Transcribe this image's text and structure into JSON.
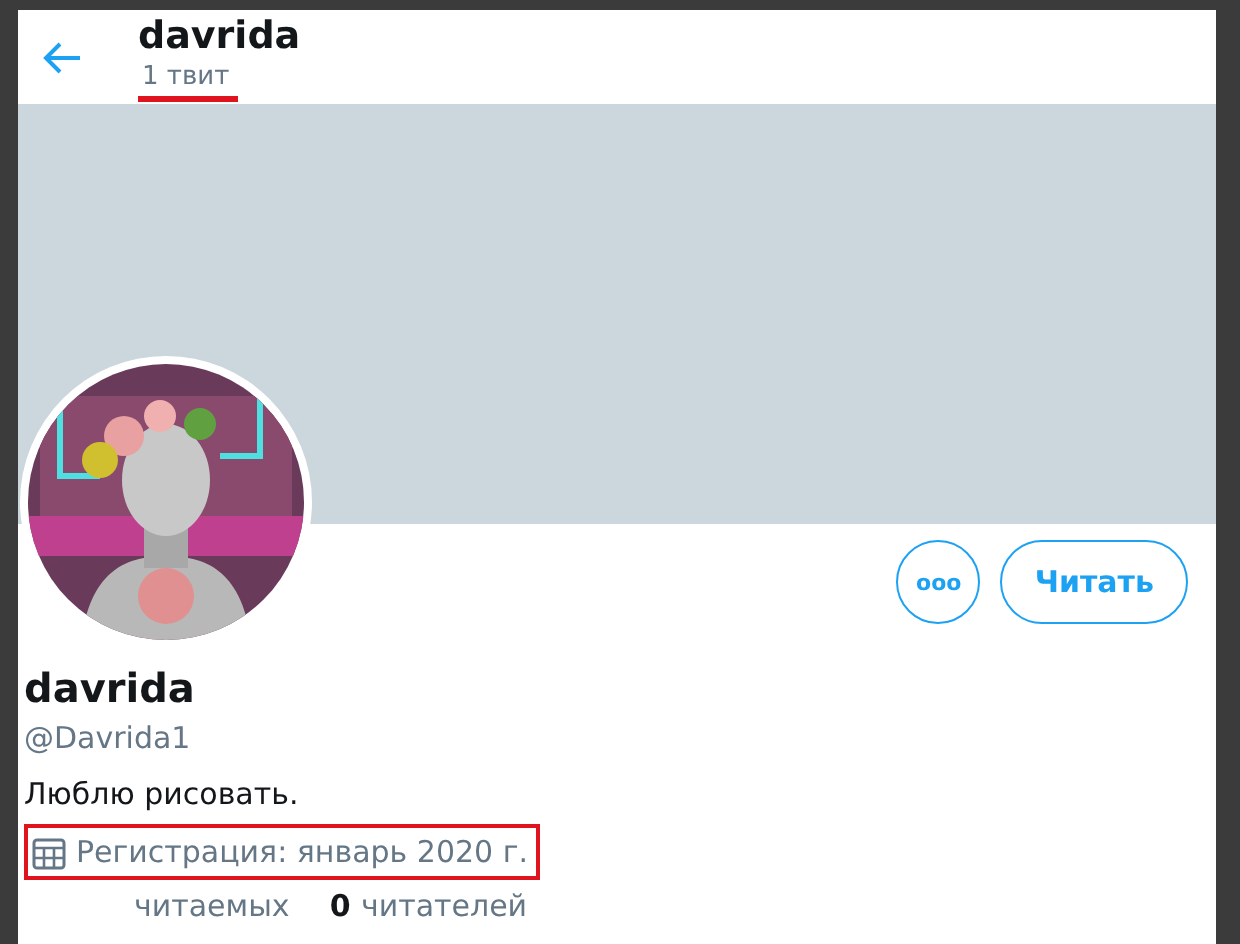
{
  "header": {
    "title": "davrida",
    "tweet_count": {
      "text": "1 твит",
      "marked": true
    }
  },
  "profile": {
    "name": "davrida",
    "handle": "@Davrida1",
    "bio": "Люблю рисовать.",
    "joined": {
      "text": "Регистрация: январь 2020 г.",
      "marked": true
    },
    "stats": [
      {
        "label": "читаемых"
      },
      {
        "count": "0",
        "label": "читателей"
      }
    ]
  },
  "buttons": {
    "more": "ooo",
    "follow": "Читать"
  }
}
